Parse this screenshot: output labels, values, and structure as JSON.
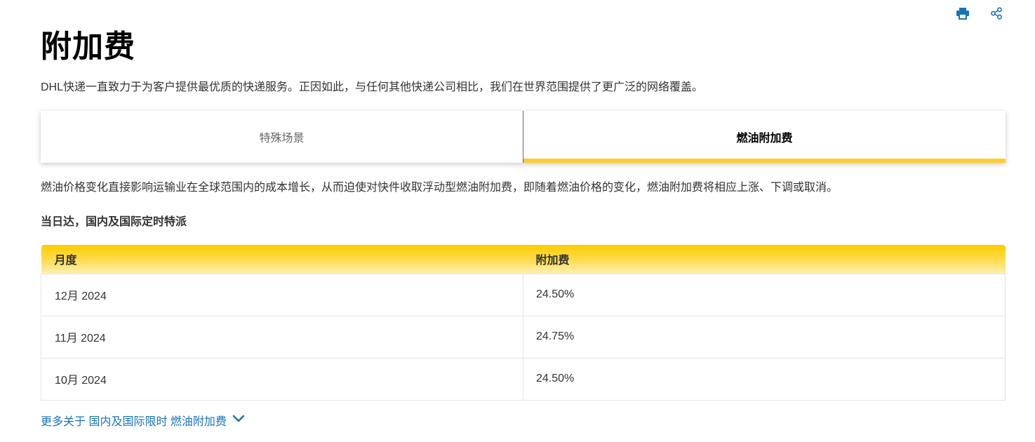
{
  "actions": {
    "print_icon": "print-icon",
    "share_icon": "share-icon"
  },
  "page": {
    "title": "附加费",
    "intro": "DHL快递一直致力于为客户提供最优质的快递服务。正因如此，与任何其他快递公司相比，我们在世界范围提供了更广泛的网络覆盖。"
  },
  "tabs": [
    {
      "label": "特殊场景",
      "active": false
    },
    {
      "label": "燃油附加费",
      "active": true
    }
  ],
  "content": {
    "description": "燃油价格变化直接影响运输业在全球范围内的成本增长，从而迫使对快件收取浮动型燃油附加费，即随着燃油价格的变化，燃油附加费将相应上涨、下调或取消。",
    "section_heading": "当日达，国内及国际定时特派"
  },
  "table": {
    "headers": [
      "月度",
      "附加费"
    ],
    "rows": [
      [
        "12月 2024",
        "24.50%"
      ],
      [
        "11月 2024",
        "24.75%"
      ],
      [
        "10月 2024",
        "24.50%"
      ]
    ]
  },
  "more_link": {
    "label": "更多关于 国内及国际限时 燃油附加费",
    "icon": "chevron-down-icon"
  },
  "colors": {
    "accent_yellow": "#ffcc33",
    "link_blue": "#1a73b8",
    "icon_blue": "#1a73b8"
  }
}
